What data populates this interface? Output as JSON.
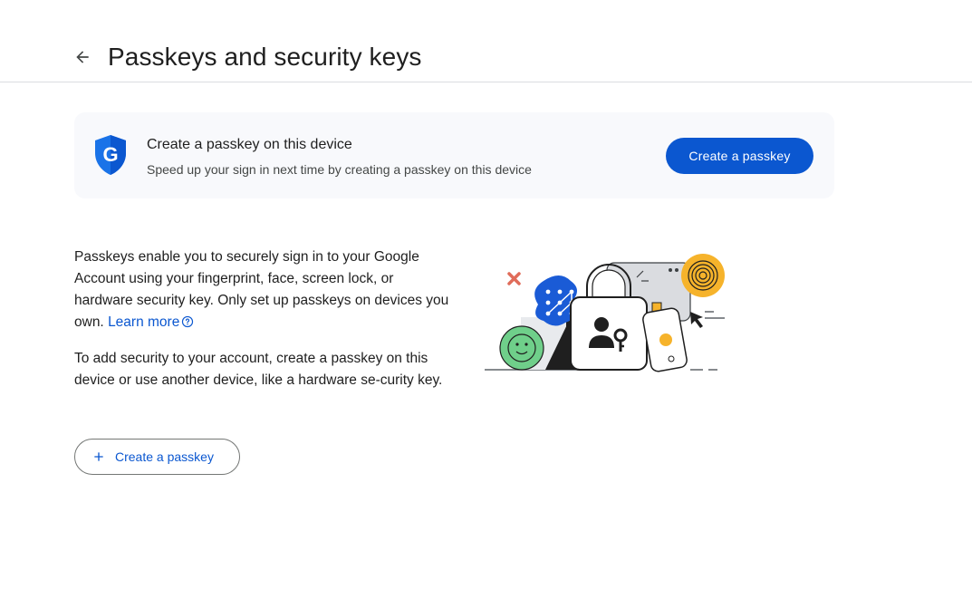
{
  "header": {
    "title": "Passkeys and security keys",
    "back_icon": "arrow-back-icon"
  },
  "promo": {
    "title": "Create a passkey on this device",
    "subtitle": "Speed up your sign in next time by creating a passkey on this device",
    "button_label": "Create a passkey",
    "icon": "google-shield-icon"
  },
  "body": {
    "paragraph1": "Passkeys enable you to securely sign in to your Google Account using your fingerprint, face, screen lock, or hardware security key. Only set up passkeys on devices you own.",
    "learn_more": "Learn more",
    "paragraph2": "To add security to your account, create a passkey on this device or use another device, like a hardware se-curity key.",
    "create_button_label": "Create a passkey"
  },
  "colors": {
    "primary": "#0b57d0",
    "card_bg": "#f8f9fc",
    "text": "#1f1f1f"
  }
}
